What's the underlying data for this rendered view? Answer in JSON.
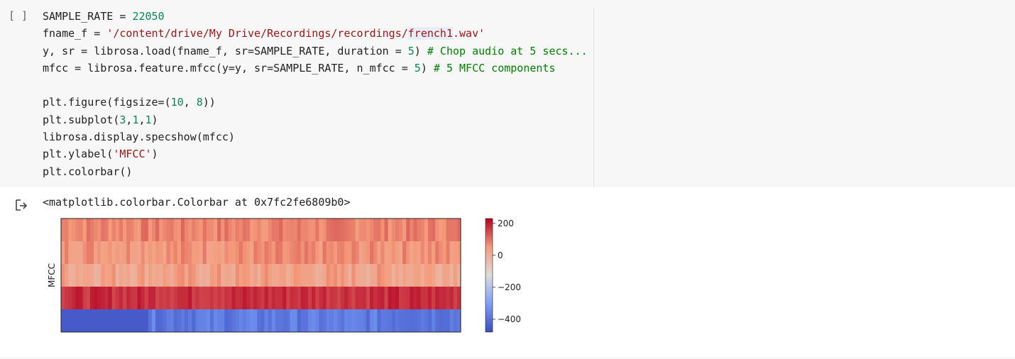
{
  "cell": {
    "run_button": "[ ]",
    "code_lines": [
      [
        {
          "t": "SAMPLE_RATE = "
        },
        {
          "t": "22050",
          "c": "num"
        }
      ],
      [
        {
          "t": "fname_f = "
        },
        {
          "t": "'/content/drive/My Drive/Recordings/recordings/",
          "c": "str"
        },
        {
          "t": "french1",
          "c": "str hl"
        },
        {
          "t": ".wav'",
          "c": "str"
        }
      ],
      [
        {
          "t": "y, sr = librosa.load(fname_f, sr=SAMPLE_RATE, duration = "
        },
        {
          "t": "5",
          "c": "num"
        },
        {
          "t": ") "
        },
        {
          "t": "# Chop audio at 5 secs...",
          "c": "cmt"
        }
      ],
      [
        {
          "t": "mfcc = librosa.feature.mfcc(y=y, sr=SAMPLE_RATE, n_mfcc = "
        },
        {
          "t": "5",
          "c": "num"
        },
        {
          "t": ") "
        },
        {
          "t": "# 5 MFCC components",
          "c": "cmt"
        }
      ],
      [
        {
          "t": ""
        }
      ],
      [
        {
          "t": "plt.figure(figsize=("
        },
        {
          "t": "10",
          "c": "num"
        },
        {
          "t": ", "
        },
        {
          "t": "8",
          "c": "num"
        },
        {
          "t": "))"
        }
      ],
      [
        {
          "t": "plt.subplot("
        },
        {
          "t": "3",
          "c": "num"
        },
        {
          "t": ","
        },
        {
          "t": "1",
          "c": "num"
        },
        {
          "t": ","
        },
        {
          "t": "1",
          "c": "num"
        },
        {
          "t": ")"
        }
      ],
      [
        {
          "t": "librosa.display.specshow(mfcc)"
        }
      ],
      [
        {
          "t": "plt.ylabel("
        },
        {
          "t": "'MFCC'",
          "c": "str"
        },
        {
          "t": ")"
        }
      ],
      [
        {
          "t": "plt.colorbar()"
        }
      ]
    ]
  },
  "output": {
    "icon": "output-arrow-icon",
    "text": "<matplotlib.colorbar.Colorbar at 0x7fc2fe6809b0>"
  },
  "chart_data": {
    "type": "heatmap",
    "ylabel": "MFCC",
    "xlabel": "",
    "rows": [
      {
        "band": 0,
        "mean": 80,
        "spread": 35
      },
      {
        "band": 1,
        "mean": 60,
        "spread": 40
      },
      {
        "band": 2,
        "mean": 30,
        "spread": 45
      },
      {
        "band": 3,
        "mean": 180,
        "spread": 30
      },
      {
        "band": 4,
        "mean": -380,
        "spread": 40
      }
    ],
    "colorbar": {
      "min": -480,
      "max": 230,
      "ticks": [
        200,
        0,
        -200,
        -400
      ],
      "tick_labels": [
        "200",
        "0",
        "−200",
        "−400"
      ],
      "colormap": "coolwarm"
    }
  }
}
